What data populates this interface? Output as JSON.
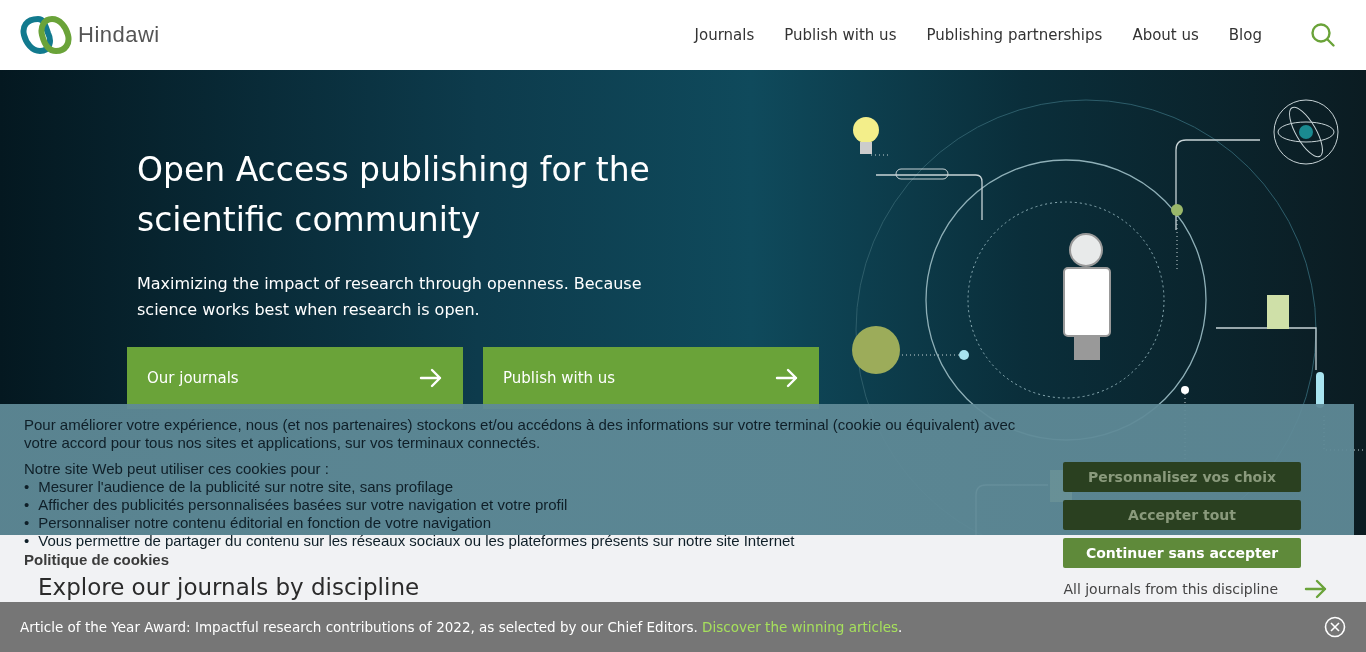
{
  "header": {
    "logo": "Hindawi",
    "nav": [
      "Journals",
      "Publish with us",
      "Publishing partnerships",
      "About us",
      "Blog"
    ]
  },
  "hero": {
    "title": "Open Access publishing for the scientific community",
    "subtitle": "Maximizing the impact of research through openness. Because science works best when research is open.",
    "buttons": [
      "Our journals",
      "Publish with us"
    ]
  },
  "discipline": {
    "heading": "Explore our journals by discipline",
    "link": "All journals from this discipline"
  },
  "cookie_banner": {
    "paragraph": "Pour améliorer votre expérience, nous (et nos partenaires) stockons et/ou accédons à des informations sur votre terminal (cookie ou équivalent) avec votre accord pour tous nos sites et applications, sur vos terminaux connectés.",
    "intro": "Notre site Web peut utiliser ces cookies pour :",
    "bullet": "•",
    "purposes": [
      "Mesurer l'audience de la publicité sur notre site, sans profilage",
      "Afficher des publicités personnalisées basées sur votre navigation et votre profil",
      "Personnaliser notre contenu éditorial en fonction de votre navigation",
      "Vous permettre de partager du contenu sur les réseaux sociaux ou les plateformes présents sur notre site Internet"
    ],
    "policy": "Politique de cookies",
    "buttons": [
      {
        "label": "Personnalisez vos choix",
        "kind": "dark"
      },
      {
        "label": "Accepter tout",
        "kind": "dark"
      },
      {
        "label": "Continuer sans accepter",
        "kind": "light"
      }
    ]
  },
  "announcement": {
    "text": "Article of the Year Award: Impactful research contributions of 2022, as selected by our Chief Editors.",
    "link": "Discover the winning articles",
    "suffix": "."
  }
}
